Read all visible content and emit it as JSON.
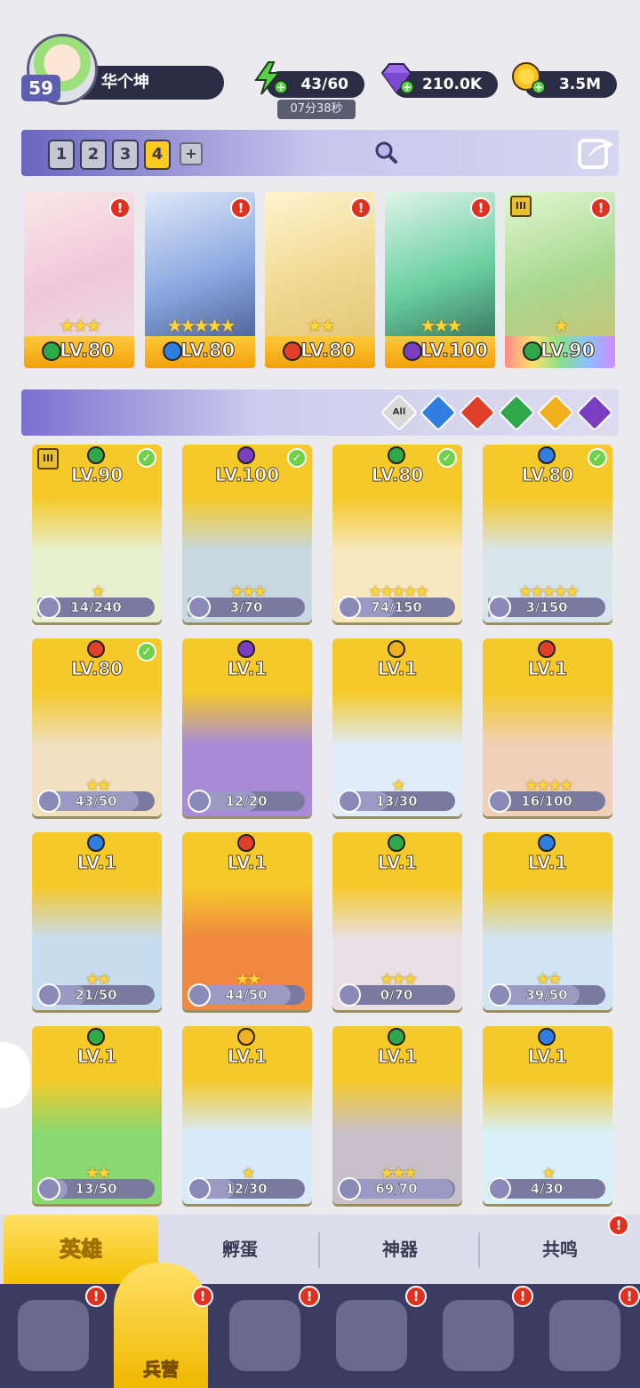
{
  "player": {
    "level": "59",
    "name": "华个坤"
  },
  "resources": {
    "energy": {
      "value": "43/60",
      "timer": "07分38秒",
      "icon": "lightning-icon"
    },
    "gems": {
      "value": "210.0K",
      "icon": "diamond-icon"
    },
    "gold": {
      "value": "3.5M",
      "icon": "coin-icon"
    }
  },
  "teams": {
    "tabs": [
      "1",
      "2",
      "3",
      "4"
    ],
    "active": "4",
    "add_label": "+"
  },
  "team_slots": [
    {
      "level": "LV.80",
      "stars": "★★★",
      "element": "wind",
      "alert": "!"
    },
    {
      "level": "LV.80",
      "stars": "★★★★★",
      "element": "water",
      "alert": "!"
    },
    {
      "level": "LV.80",
      "stars": "★★",
      "element": "fire",
      "alert": "!"
    },
    {
      "level": "LV.100",
      "stars": "★★★",
      "element": "dark",
      "alert": "!"
    },
    {
      "level": "LV.90",
      "stars": "★",
      "element": "wind",
      "alert": "!",
      "rank": "III"
    }
  ],
  "filters": {
    "all_label": "All",
    "elements": [
      "water",
      "fire",
      "wind",
      "light",
      "dark"
    ]
  },
  "heroes": [
    {
      "level": "LV.90",
      "element": "wind",
      "progress": "14/240",
      "stars": "★",
      "check": "✓",
      "rank": "III"
    },
    {
      "level": "LV.100",
      "element": "dark",
      "progress": "3/70",
      "stars": "★★★",
      "check": "✓"
    },
    {
      "level": "LV.80",
      "element": "wind",
      "progress": "74/150",
      "stars": "★★★★★",
      "check": "✓"
    },
    {
      "level": "LV.80",
      "element": "water",
      "progress": "3/150",
      "stars": "★★★★★",
      "check": "✓"
    },
    {
      "level": "LV.80",
      "element": "fire",
      "progress": "43/50",
      "stars": "★★",
      "check": "✓"
    },
    {
      "level": "LV.1",
      "element": "dark",
      "progress": "12/20",
      "stars": "",
      "check": ""
    },
    {
      "level": "LV.1",
      "element": "light",
      "progress": "13/30",
      "stars": "★",
      "check": ""
    },
    {
      "level": "LV.1",
      "element": "fire",
      "progress": "16/100",
      "stars": "★★★★",
      "check": ""
    },
    {
      "level": "LV.1",
      "element": "water",
      "progress": "21/50",
      "stars": "★★",
      "check": ""
    },
    {
      "level": "LV.1",
      "element": "fire",
      "progress": "44/50",
      "stars": "★★",
      "check": ""
    },
    {
      "level": "LV.1",
      "element": "wind",
      "progress": "0/70",
      "stars": "★★★",
      "check": ""
    },
    {
      "level": "LV.1",
      "element": "water",
      "progress": "39/50",
      "stars": "★★",
      "check": ""
    },
    {
      "level": "LV.1",
      "element": "wind",
      "progress": "13/50",
      "stars": "★★",
      "check": ""
    },
    {
      "level": "LV.1",
      "element": "light",
      "progress": "12/30",
      "stars": "★",
      "check": ""
    },
    {
      "level": "LV.1",
      "element": "wind",
      "progress": "69/70",
      "stars": "★★★",
      "check": ""
    },
    {
      "level": "LV.1",
      "element": "water",
      "progress": "4/30",
      "stars": "★",
      "check": ""
    }
  ],
  "tabs": {
    "heroes": "英雄",
    "hatch": "孵蛋",
    "artifacts": "神器",
    "resonance": "共鸣"
  },
  "nav": {
    "barracks": "兵营",
    "alert": "!"
  },
  "colors": {
    "wind": "#2fa84a",
    "water": "#2f7ee0",
    "fire": "#e0402a",
    "light": "#f0b020",
    "dark": "#7a3fc0",
    "accent": "#ffc93a"
  }
}
